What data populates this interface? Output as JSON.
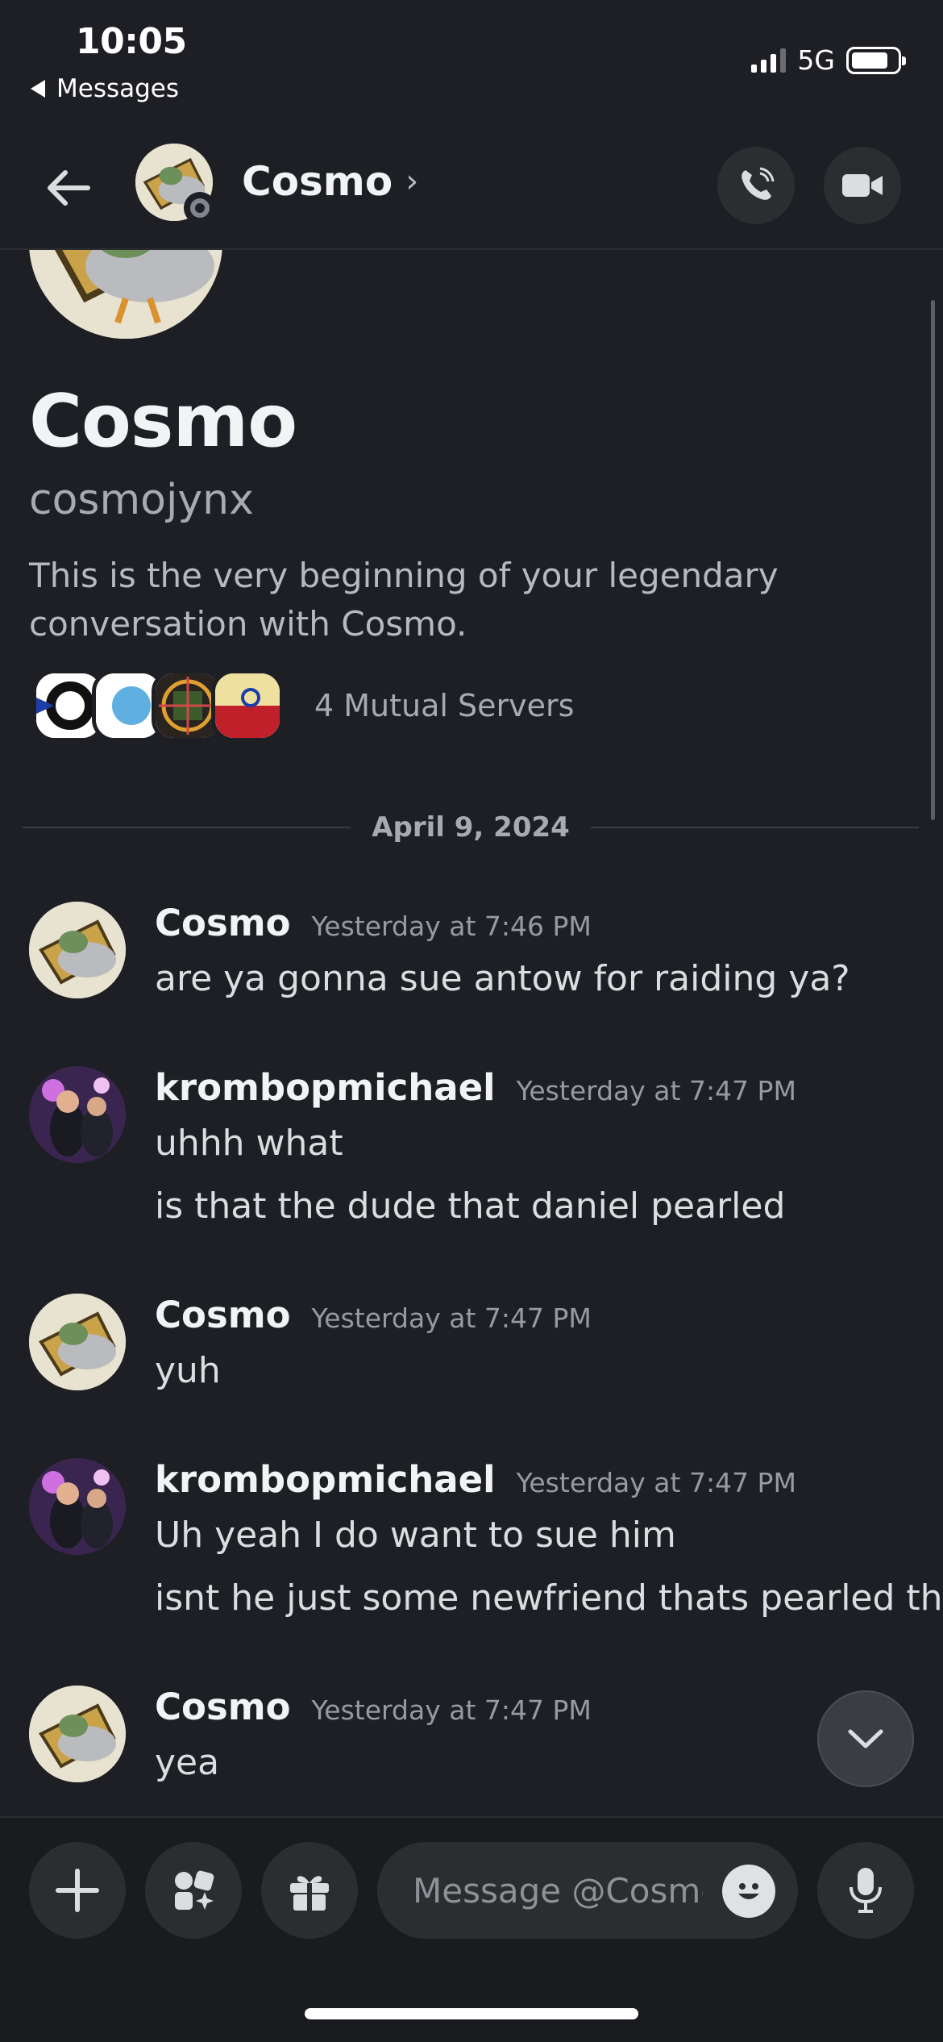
{
  "status_bar": {
    "time": "10:05",
    "back_app": "Messages",
    "network": "5G"
  },
  "header": {
    "title": "Cosmo",
    "chevron": "›"
  },
  "intro": {
    "display_name": "Cosmo",
    "username": "cosmojynx",
    "description": "This is the very beginning of your legendary conversation with Cosmo.",
    "mutual_servers_label": "4 Mutual Servers"
  },
  "date_divider": "April 9, 2024",
  "messages": [
    {
      "author": "Cosmo",
      "time": "Yesterday at 7:46 PM",
      "lines": [
        "are ya gonna sue antow for raiding ya?"
      ]
    },
    {
      "author": "krombopmichael",
      "time": "Yesterday at 7:47 PM",
      "lines": [
        "uhhh what",
        "is that the dude that daniel pearled"
      ]
    },
    {
      "author": "Cosmo",
      "time": "Yesterday at 7:47 PM",
      "lines": [
        "yuh"
      ]
    },
    {
      "author": "krombopmichael",
      "time": "Yesterday at 7:47 PM",
      "lines": [
        "Uh yeah I do want to sue him",
        "isnt he just some newfriend thats pearled tho"
      ]
    },
    {
      "author": "Cosmo",
      "time": "Yesterday at 7:47 PM",
      "lines": [
        "yea"
      ]
    }
  ],
  "composer": {
    "placeholder": "Message @Cosmo"
  },
  "colors": {
    "background": "#1e1f24",
    "button": "#2b2d31",
    "timestamp": "#949ba4"
  }
}
